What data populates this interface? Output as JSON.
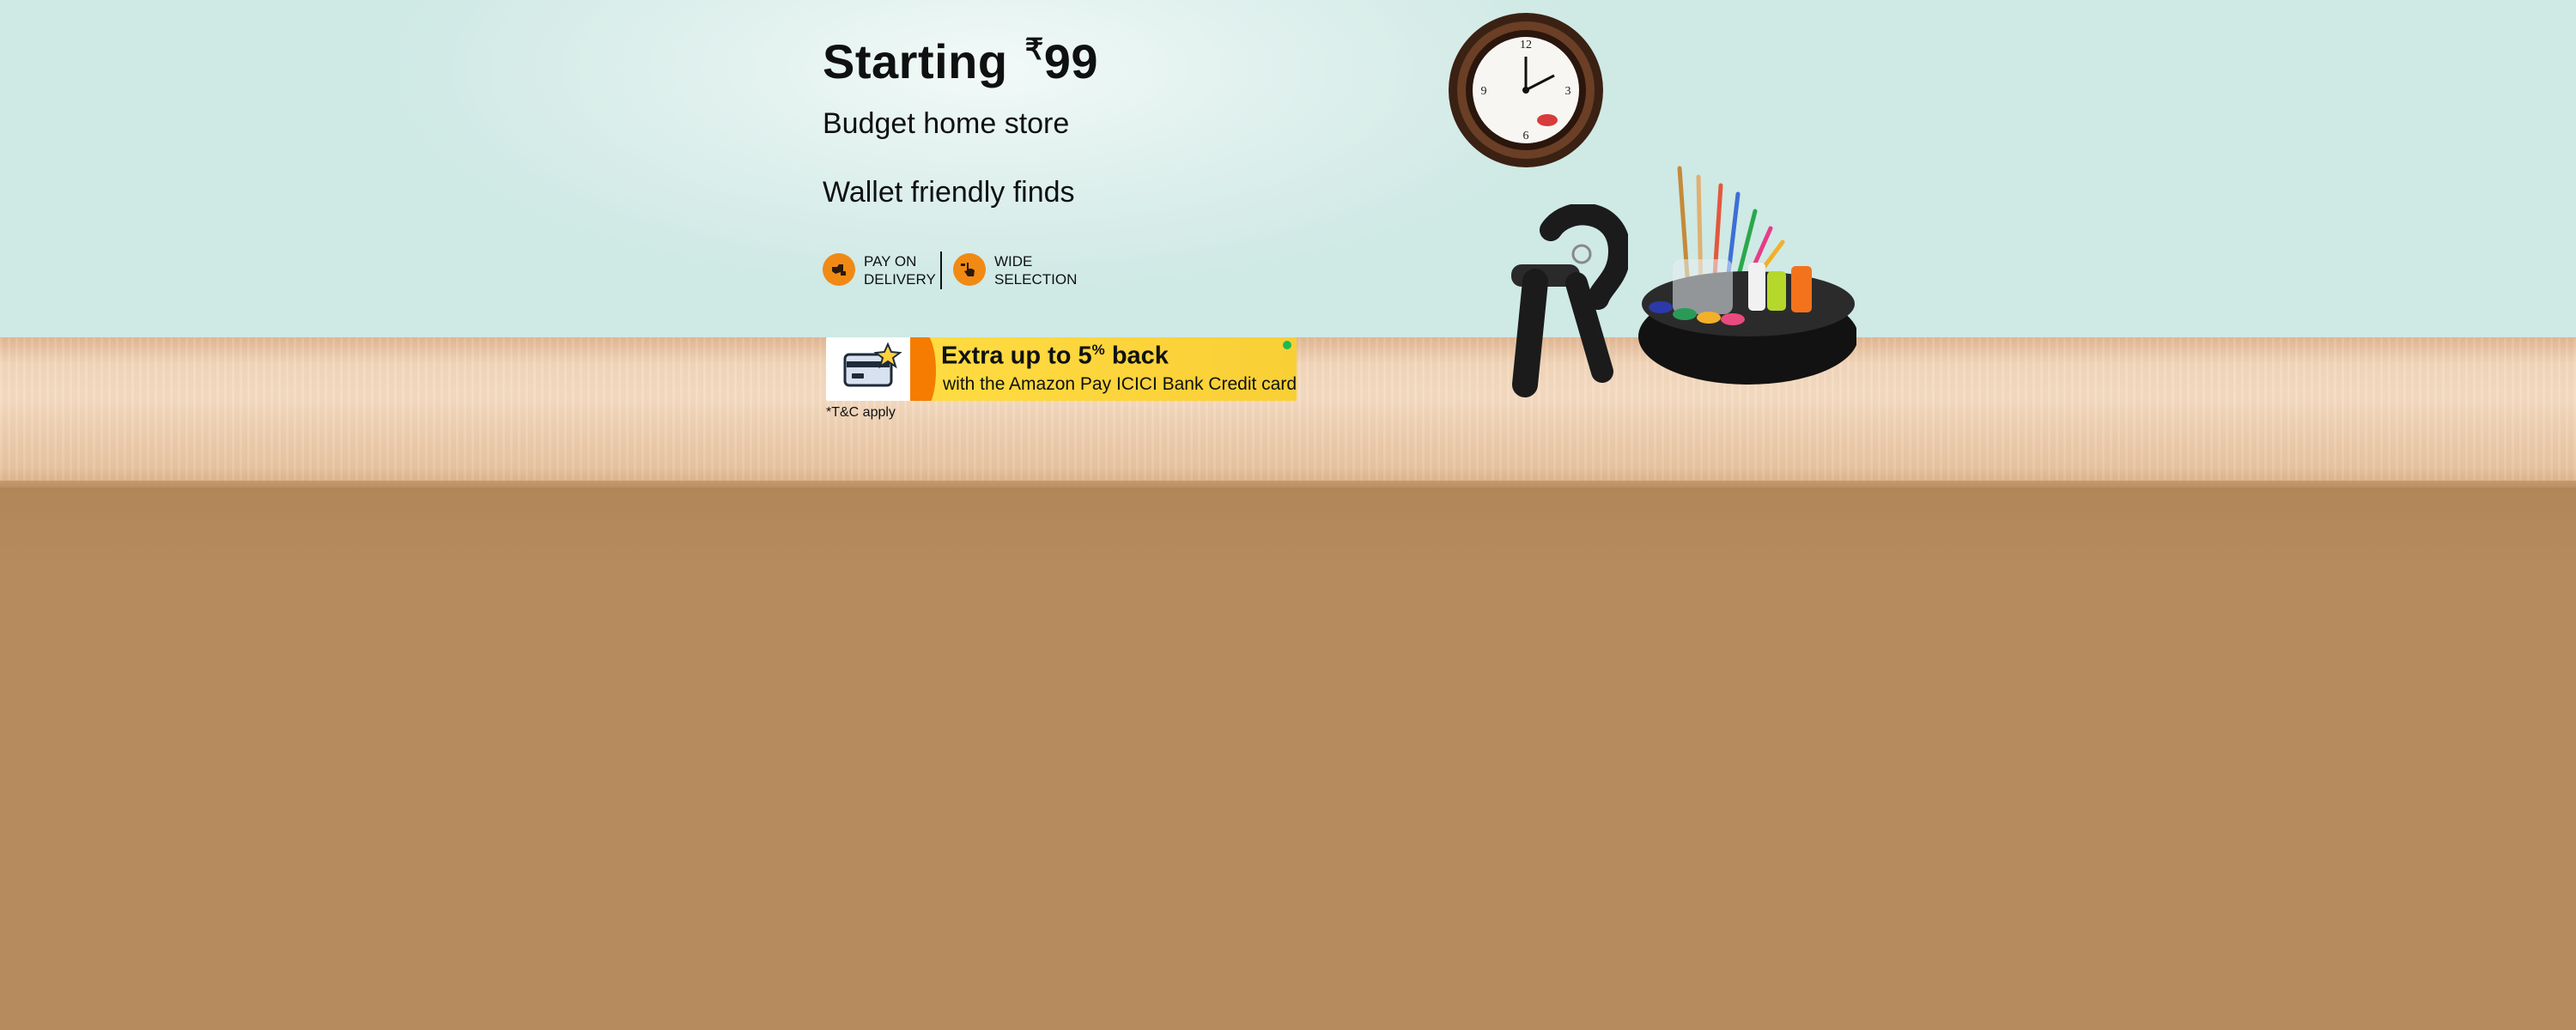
{
  "hero": {
    "title_prefix": "Starting",
    "currency_symbol": "₹",
    "price": "99",
    "subtitle": "Budget home store",
    "tagline": "Wallet friendly finds"
  },
  "badges": [
    {
      "icon": "delivery-icon",
      "line1": "PAY ON",
      "line2": "DELIVERY"
    },
    {
      "icon": "hand-pointer-icon",
      "line1": "WIDE",
      "line2": "SELECTION"
    }
  ],
  "offer": {
    "title": "Extra up to 5",
    "percent": "%",
    "title_suffix": " back",
    "subtitle": "with the Amazon Pay ICICI Bank Credit card",
    "icon": "credit-card-icon",
    "terms": "*T&C apply"
  },
  "products": {
    "clock": {
      "icon": "wall-clock-icon"
    },
    "gripper": {
      "icon": "hand-gripper-icon"
    },
    "organizer": {
      "icon": "art-supplies-organizer-icon"
    }
  },
  "colors": {
    "wall": "#dff0ed",
    "shelf": "#f3d7bc",
    "floor": "#b68b5d",
    "badge_orange": "#f08a15",
    "offer_yellow": "#fcd33a",
    "offer_accent": "#f57c00",
    "text": "#0f1111"
  }
}
